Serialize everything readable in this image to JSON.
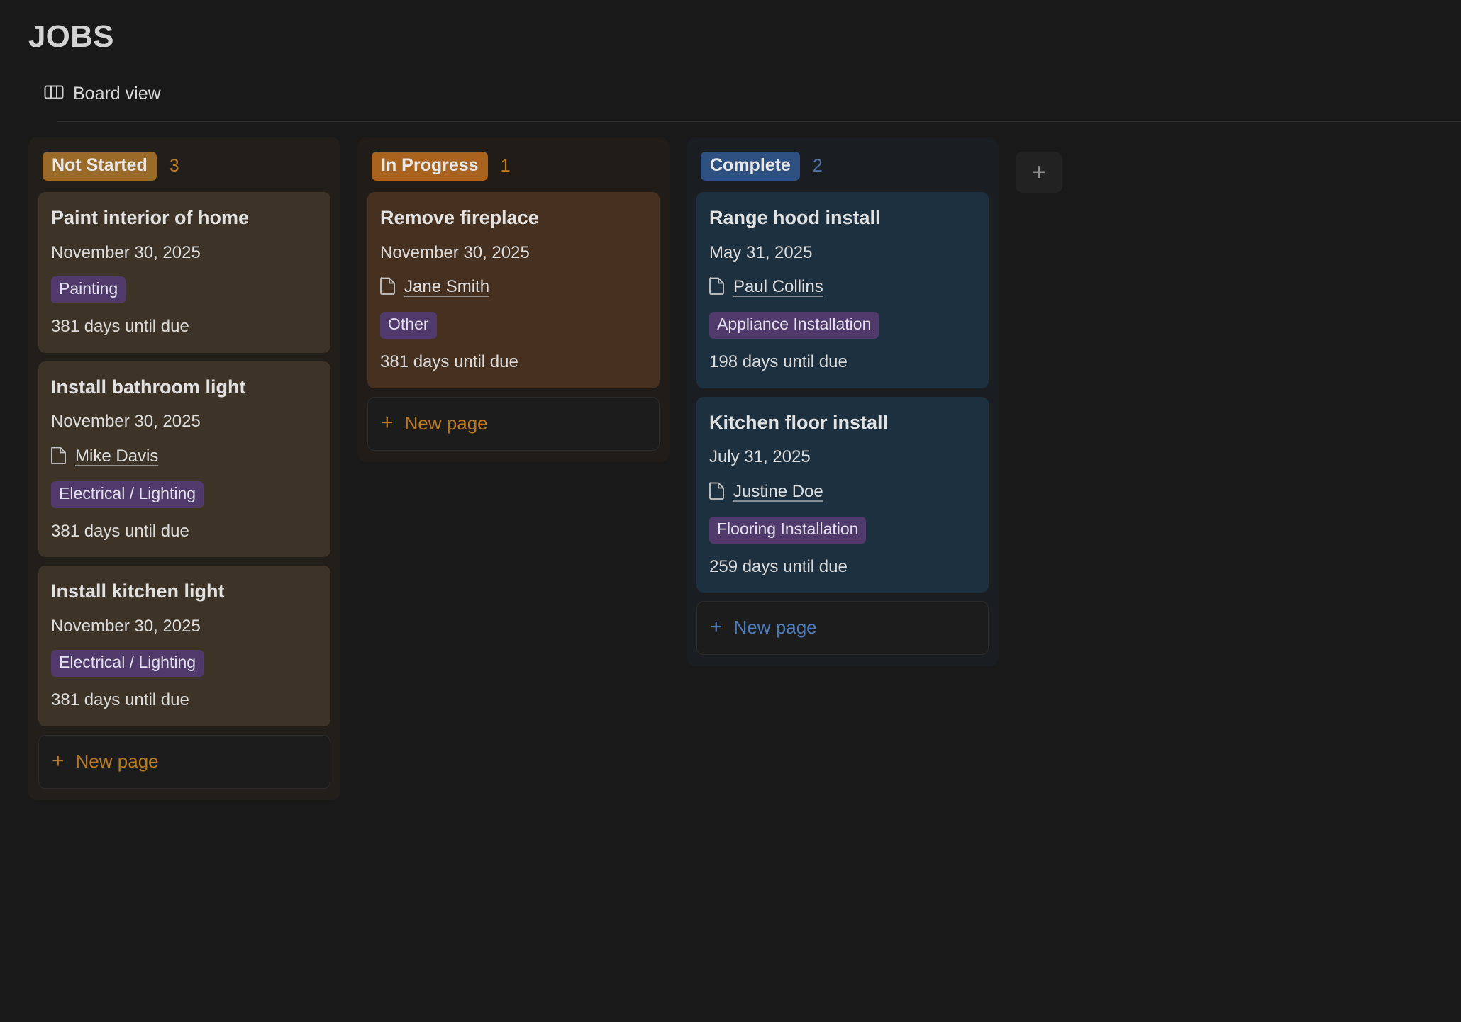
{
  "header": {
    "title": "JOBS",
    "view_label": "Board view",
    "view_icon": "board-columns-icon"
  },
  "board": {
    "add_column_label": "+",
    "columns": [
      {
        "id": "not-started",
        "status": "Not Started",
        "count": "3",
        "tone": "notstarted",
        "new_page_label": "New page",
        "new_page_plus": "+",
        "cards": [
          {
            "title": "Paint interior of home",
            "date": "November 30, 2025",
            "person": null,
            "tag": "Painting",
            "due": "381 days until due"
          },
          {
            "title": "Install bathroom light",
            "date": "November 30, 2025",
            "person": "Mike Davis",
            "tag": "Electrical / Lighting",
            "due": "381 days until due"
          },
          {
            "title": "Install kitchen light",
            "date": "November 30, 2025",
            "person": null,
            "tag": "Electrical / Lighting",
            "due": "381 days until due"
          }
        ]
      },
      {
        "id": "in-progress",
        "status": "In Progress",
        "count": "1",
        "tone": "inprogress",
        "new_page_label": "New page",
        "new_page_plus": "+",
        "cards": [
          {
            "title": "Remove fireplace",
            "date": "November 30, 2025",
            "person": "Jane Smith",
            "tag": "Other",
            "due": "381 days until due"
          }
        ]
      },
      {
        "id": "complete",
        "status": "Complete",
        "count": "2",
        "tone": "complete",
        "new_page_label": "New page",
        "new_page_plus": "+",
        "cards": [
          {
            "title": "Range hood install",
            "date": "May 31, 2025",
            "person": "Paul Collins",
            "tag": "Appliance Installation",
            "due": "198 days until due"
          },
          {
            "title": "Kitchen floor install",
            "date": "July 31, 2025",
            "person": "Justine Doe",
            "tag": "Flooring Installation",
            "due": "259 days until due"
          }
        ]
      }
    ]
  },
  "colors": {
    "page_background": "#191919",
    "badge_not_started": "#9a6a28",
    "badge_in_progress": "#a9631f",
    "badge_complete": "#2d5080",
    "tag_purple": "#503a6b",
    "accent_amber": "#bb791f",
    "accent_blue": "#4f7cb8"
  }
}
